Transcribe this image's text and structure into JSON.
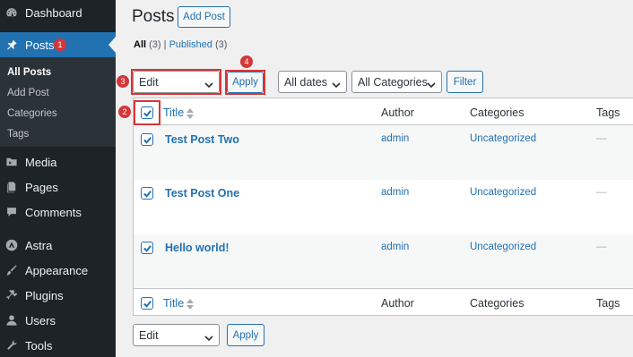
{
  "sidebar": {
    "items": [
      {
        "key": "dashboard",
        "label": "Dashboard",
        "icon": "dashboard-icon"
      },
      {
        "key": "posts",
        "label": "Posts",
        "icon": "pin-icon"
      },
      {
        "key": "media",
        "label": "Media",
        "icon": "media-icon"
      },
      {
        "key": "pages",
        "label": "Pages",
        "icon": "pages-icon"
      },
      {
        "key": "comments",
        "label": "Comments",
        "icon": "comment-icon"
      },
      {
        "key": "astra",
        "label": "Astra",
        "icon": "astra-icon"
      },
      {
        "key": "appearance",
        "label": "Appearance",
        "icon": "brush-icon"
      },
      {
        "key": "plugins",
        "label": "Plugins",
        "icon": "plug-icon"
      },
      {
        "key": "users",
        "label": "Users",
        "icon": "user-icon"
      },
      {
        "key": "tools",
        "label": "Tools",
        "icon": "wrench-icon"
      }
    ],
    "submenu": [
      "All Posts",
      "Add Post",
      "Categories",
      "Tags"
    ]
  },
  "badges": {
    "b1": "1",
    "b2": "2",
    "b3": "3",
    "b4": "4"
  },
  "header": {
    "title": "Posts",
    "add_button": "Add Post"
  },
  "filters_nav": {
    "all_label": "All",
    "all_count": "(3)",
    "separator": "|",
    "published_label": "Published",
    "published_count": "(3)"
  },
  "bulk": {
    "action_top": "Edit",
    "apply": "Apply",
    "dates": "All dates",
    "categories": "All Categories",
    "filter": "Filter",
    "action_bottom": "Edit"
  },
  "table": {
    "columns": {
      "title": "Title",
      "author": "Author",
      "categories": "Categories",
      "tags": "Tags"
    },
    "rows": [
      {
        "title": "Test Post Two",
        "author": "admin",
        "category": "Uncategorized",
        "tags": "—",
        "checked": true
      },
      {
        "title": "Test Post One",
        "author": "admin",
        "category": "Uncategorized",
        "tags": "—",
        "checked": true
      },
      {
        "title": "Hello world!",
        "author": "admin",
        "category": "Uncategorized",
        "tags": "—",
        "checked": true
      }
    ]
  },
  "colors": {
    "sidebar_bg": "#1d2327",
    "accent": "#2271b1",
    "highlight": "#d63638"
  }
}
